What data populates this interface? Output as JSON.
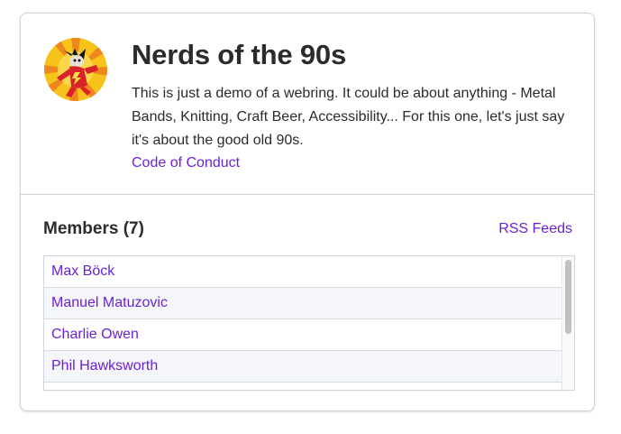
{
  "webring": {
    "title": "Nerds of the 90s",
    "description": "This is just a demo of a webring. It could be about anything - Metal Bands, Knitting, Craft Beer, Accessibility... For this one, let's just say it's about the good old 90s.",
    "code_of_conduct_label": "Code of Conduct",
    "logo_icon": "freakazoid-logo-icon"
  },
  "members": {
    "heading": "Members (7)",
    "rss_label": "RSS Feeds",
    "items": [
      {
        "name": "Max Böck"
      },
      {
        "name": "Manuel Matuzovic"
      },
      {
        "name": "Charlie Owen"
      },
      {
        "name": "Phil Hawksworth"
      },
      {
        "name": ""
      }
    ]
  },
  "colors": {
    "link": "#6b21d8",
    "text": "#2b2b2b",
    "border": "#cfcfd6",
    "row_alt": "#f5f6f9",
    "logo_bg": "#f7c21a",
    "logo_rays": "#f0861f"
  }
}
